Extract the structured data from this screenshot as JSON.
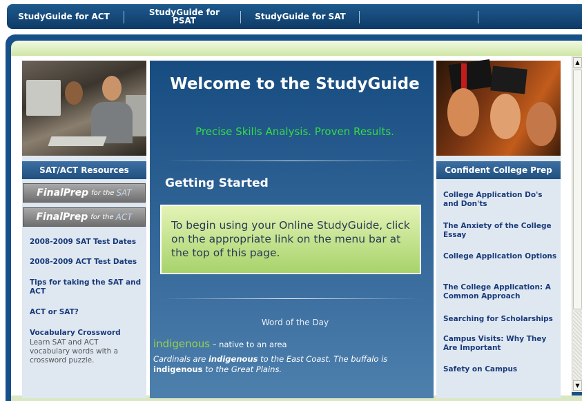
{
  "topnav": {
    "items": [
      {
        "label": "StudyGuide for ACT"
      },
      {
        "label": "StudyGuide for PSAT"
      },
      {
        "label": "StudyGuide for SAT"
      }
    ]
  },
  "left": {
    "header": "SAT/ACT Resources",
    "finalprep_sat": {
      "brand": "FinalPrep",
      "for": "for the",
      "exam": "SAT"
    },
    "finalprep_act": {
      "brand": "FinalPrep",
      "for": "for the",
      "exam": "ACT"
    },
    "links": [
      "2008-2009 SAT Test Dates",
      "2008-2009 ACT Test Dates",
      "Tips for taking the SAT and ACT",
      "ACT or SAT?",
      "Vocabulary Crossword"
    ],
    "crossword_desc": "Learn SAT and ACT vocabulary words with a crossword puzzle."
  },
  "center": {
    "welcome": "Welcome to the StudyGuide",
    "tagline": "Precise Skills Analysis. Proven Results.",
    "getting_started": "Getting Started",
    "instructions": "To begin using your Online StudyGuide, click on the appropriate link on the menu bar at the top of this page.",
    "word_of_day": {
      "title": "Word of the Day",
      "word": "indigenous",
      "definition": " – native to an area",
      "example_1": "Cardinals are ",
      "example_2": " to the East Coast. The buffalo is ",
      "example_3": " to the Great Plains."
    }
  },
  "right": {
    "header": "Confident College Prep",
    "links": [
      "College Application Do's and Don'ts",
      "The Anxiety of the College Essay",
      "College Application Options",
      "The College Application: A Common Approach",
      "Searching for Scholarships",
      "Campus Visits: Why They Are Important",
      "Safety on Campus"
    ]
  },
  "colors": {
    "nav": "#0e3a66",
    "accent_green": "#33dd44",
    "link": "#1a3a7a",
    "panel_bg": "#dfe8f1"
  }
}
